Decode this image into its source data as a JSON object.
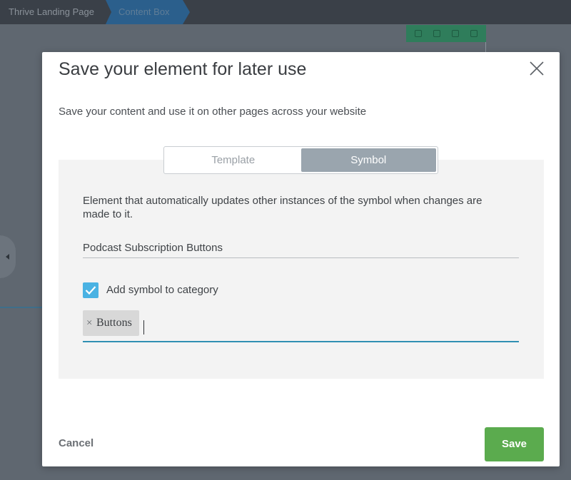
{
  "breadcrumb": {
    "items": [
      "Thrive Landing Page",
      "Content Box"
    ]
  },
  "modal": {
    "title": "Save your element for later use",
    "subtitle": "Save your content and use it on other pages across your website",
    "tabs": [
      {
        "label": "Template",
        "active": false
      },
      {
        "label": "Symbol",
        "active": true
      }
    ],
    "description": "Element that automatically updates other instances of the symbol when changes are made to it.",
    "name_field": {
      "value": "Podcast Subscription Buttons"
    },
    "category_checkbox": {
      "checked": true,
      "label": "Add symbol to category"
    },
    "tags": [
      {
        "label": "Buttons",
        "remove": "×"
      }
    ],
    "cancel_label": "Cancel",
    "save_label": "Save"
  },
  "colors": {
    "accent": "#4ab2e3",
    "save": "#5bab4e",
    "active_tab": "#9aa5ae",
    "tag_underline": "#2f8fb2"
  },
  "icons": [
    "close-icon",
    "checkmark-icon",
    "move-icon",
    "save-icon",
    "copy-icon",
    "delete-icon",
    "arrow-left-icon"
  ]
}
